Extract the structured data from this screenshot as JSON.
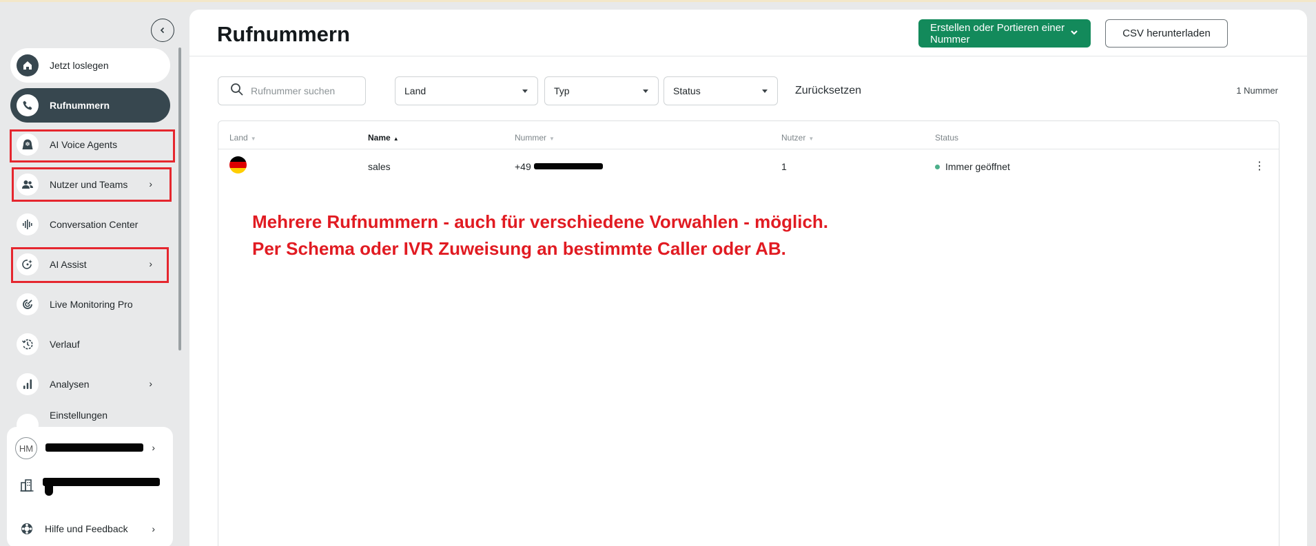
{
  "sidebar": {
    "items": [
      {
        "label": "Jetzt loslegen"
      },
      {
        "label": "Rufnummern"
      },
      {
        "label": "AI Voice Agents"
      },
      {
        "label": "Nutzer und Teams",
        "chevron": "›"
      },
      {
        "label": "Conversation Center"
      },
      {
        "label": "AI Assist",
        "chevron": "›"
      },
      {
        "label": "Live Monitoring Pro"
      },
      {
        "label": "Verlauf"
      },
      {
        "label": "Analysen",
        "chevron": "›"
      },
      {
        "label": "Einstellungen"
      }
    ],
    "bottom": {
      "avatar_initials": "HM",
      "help_label": "Hilfe und Feedback",
      "chevron": "›"
    }
  },
  "header": {
    "title": "Rufnummern",
    "primary_button": "Erstellen oder Portieren einer Nummer",
    "csv_button": "CSV herunterladen"
  },
  "filters": {
    "search_placeholder": "Rufnummer suchen",
    "land": "Land",
    "typ": "Typ",
    "status": "Status",
    "reset": "Zurücksetzen",
    "count": "1 Nummer"
  },
  "table": {
    "columns": [
      "Land",
      "Name",
      "Nummer",
      "Nutzer",
      "Status"
    ],
    "rows": [
      {
        "country": "DE",
        "name": "sales",
        "number_prefix": "+49",
        "users": "1",
        "status": "Immer geöffnet"
      }
    ]
  },
  "annotation": {
    "line1": "Mehrere Rufnummern - auch für verschiedene Vorwahlen - möglich.",
    "line2": "Per Schema oder IVR Zuweisung an bestimmte Caller oder AB."
  },
  "colors": {
    "primary": "#138a5b",
    "active_nav": "#37474f",
    "annotation": "#e11b22",
    "status_dot": "#4caf8a"
  }
}
